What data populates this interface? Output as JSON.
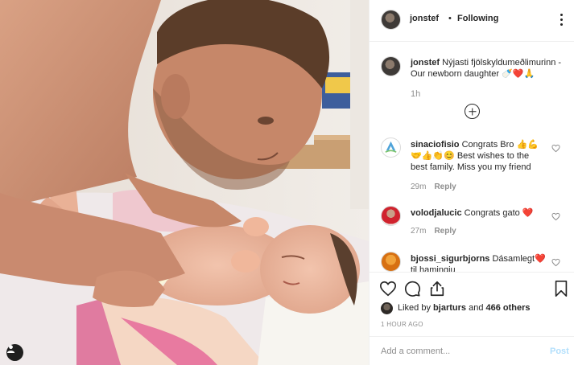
{
  "post": {
    "username": "jonstef",
    "follow_separator": "•",
    "follow_status": "Following"
  },
  "caption": {
    "username": "jonstef",
    "text": "Nýjasti fjölskyldumeðlimurinn - Our newborn daughter 🍼❤️🙏",
    "time": "1h"
  },
  "comments": [
    {
      "username": "sinaciofisio",
      "text": "Congrats Bro 👍💪🤝👍👏😊 Best wishes to the best family. Miss you my friend",
      "time": "29m",
      "reply_label": "Reply"
    },
    {
      "username": "volodjalucic",
      "text": "Congrats gato ❤️",
      "time": "27m",
      "reply_label": "Reply"
    },
    {
      "username": "bjossi_sigurbjorns",
      "text": "Dásamlegt❤️ til hamingju"
    }
  ],
  "likes": {
    "prefix": "Liked by",
    "user": "bjarturs",
    "conjunction": "and",
    "others": "466 others"
  },
  "timestamp": "1 HOUR AGO",
  "add_comment": {
    "placeholder": "Add a comment...",
    "post_label": "Post"
  },
  "icons": {
    "heart": "heart-icon",
    "comment": "comment-icon",
    "share": "share-icon",
    "save": "bookmark-icon",
    "more": "more-options-icon",
    "load_more": "plus-circle-icon",
    "user_tag": "user-tag-icon"
  },
  "colors": {
    "text": "#262626",
    "muted": "#8e8e8e",
    "border": "#efefef",
    "post_disabled": "#b2dffc",
    "heart_red": "#ed4956"
  }
}
